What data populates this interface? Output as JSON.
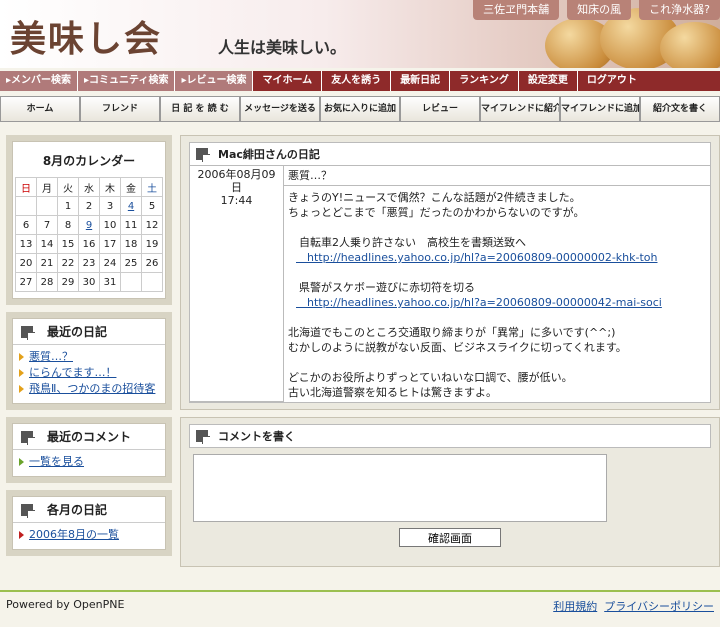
{
  "header": {
    "logo": "美味し会",
    "tagline": "人生は美味しい。",
    "ads": [
      "三佐ヱ門本舗",
      "知床の風",
      "これ浄水器?"
    ]
  },
  "nav_primary": {
    "left": [
      "▸メンバー検索",
      "▸コミュニティ検索",
      "▸レビュー検索"
    ],
    "right": [
      "マイホーム",
      "友人を誘う",
      "最新日記",
      "ランキング",
      "設定変更",
      "ログアウト"
    ]
  },
  "nav_secondary": [
    "ホーム",
    "フレンド",
    "日 記 を 読 む",
    "メッセージを送る",
    "お気に入りに追加",
    "レビュー",
    "マイフレンドに紹介",
    "マイフレンドに追加",
    "紹介文を書く"
  ],
  "calendar": {
    "title": "8月のカレンダー",
    "weekdays": [
      "日",
      "月",
      "火",
      "水",
      "木",
      "金",
      "土"
    ],
    "weeks": [
      [
        "",
        "",
        "1",
        "2",
        "3",
        "4",
        "5"
      ],
      [
        "6",
        "7",
        "8",
        "9",
        "10",
        "11",
        "12"
      ],
      [
        "13",
        "14",
        "15",
        "16",
        "17",
        "18",
        "19"
      ],
      [
        "20",
        "21",
        "22",
        "23",
        "24",
        "25",
        "26"
      ],
      [
        "27",
        "28",
        "29",
        "30",
        "31",
        "",
        ""
      ]
    ],
    "links": [
      "4",
      "9"
    ]
  },
  "recent_diary": {
    "title": "最近の日記",
    "items": [
      "悪質…？",
      "にらんでます…！",
      "飛鳥Ⅱ、つかのまの招待客"
    ]
  },
  "recent_comments": {
    "title": "最近のコメント",
    "items": [
      "一覧を見る"
    ]
  },
  "monthly_diary": {
    "title": "各月の日記",
    "items": [
      "2006年8月の一覧"
    ]
  },
  "diary": {
    "header": "Mac緋田さんの日記",
    "date": "2006年08月09日",
    "time": "17:44",
    "subject": "悪質…？",
    "lines": [
      "きょうのY!ニュースで偶然？こんな話題が2件続きました。",
      "ちょっとどこまで「悪質」だったのかわからないのですが。",
      "",
      "　自転車2人乗り許さない　高校生を書類送致へ",
      "　http://headlines.yahoo.co.jp/hl?a=20060809-00000002-khk-toh",
      "",
      "　県警がスケボー遊びに赤切符を切る",
      "　http://headlines.yahoo.co.jp/hl?a=20060809-00000042-mai-soci",
      "",
      "北海道でもこのところ交通取り締まりが「異常」に多いです(^^;)",
      "むかしのように説教がない反面、ビジネスライクに切ってくれます。",
      "",
      "どこかのお役所よりずっとていねいな口調で、腰が低い。",
      "古い北海道警察を知るヒトは驚きますよ。"
    ]
  },
  "comment": {
    "header": "コメントを書く",
    "button": "確認画面"
  },
  "footer": {
    "powered": "Powered by OpenPNE",
    "links": [
      "利用規約",
      "プライバシーポリシー"
    ]
  }
}
